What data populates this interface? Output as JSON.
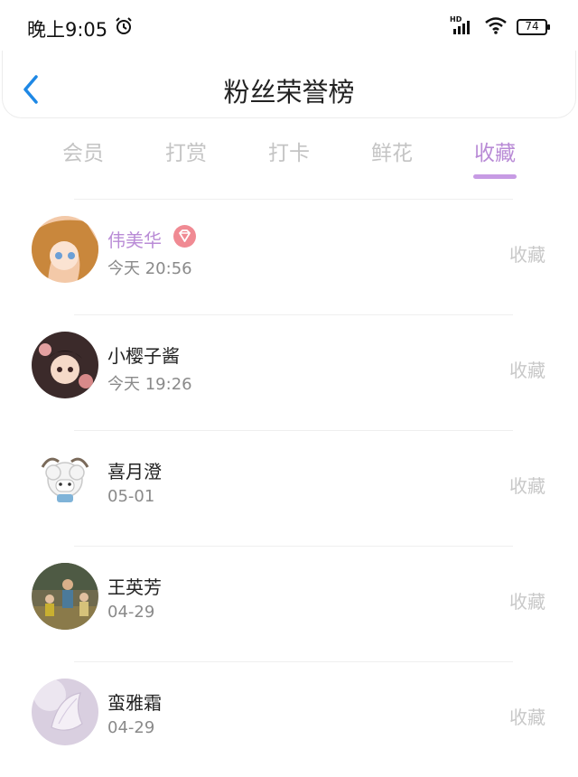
{
  "status_bar": {
    "time": "晚上9:05",
    "network_label": "HD",
    "battery": "74",
    "icons": [
      "alarm-icon",
      "signal-icon",
      "wifi-icon",
      "battery-icon"
    ]
  },
  "header": {
    "title": "粉丝荣誉榜",
    "back_icon": "chevron-left-icon"
  },
  "tabs": [
    {
      "label": "会员",
      "active": false
    },
    {
      "label": "打赏",
      "active": false
    },
    {
      "label": "打卡",
      "active": false
    },
    {
      "label": "鲜花",
      "active": false
    },
    {
      "label": "收藏",
      "active": true
    }
  ],
  "colors": {
    "accent": "#b98bd6",
    "badge": "#f08a93",
    "inactive_tab": "#c4c4c4",
    "muted_text": "#8a8a8a",
    "back_arrow": "#1e88e5"
  },
  "fans": [
    {
      "name": "伟美华",
      "time": "今天 20:56",
      "action": "收藏",
      "vip": true
    },
    {
      "name": "小樱子酱",
      "time": "今天 19:26",
      "action": "收藏",
      "vip": false
    },
    {
      "name": "喜月澄",
      "time": "05-01",
      "action": "收藏",
      "vip": false
    },
    {
      "name": "王英芳",
      "time": "04-29",
      "action": "收藏",
      "vip": false
    },
    {
      "name": "蛮雅霜",
      "time": "04-29",
      "action": "收藏",
      "vip": false
    }
  ]
}
